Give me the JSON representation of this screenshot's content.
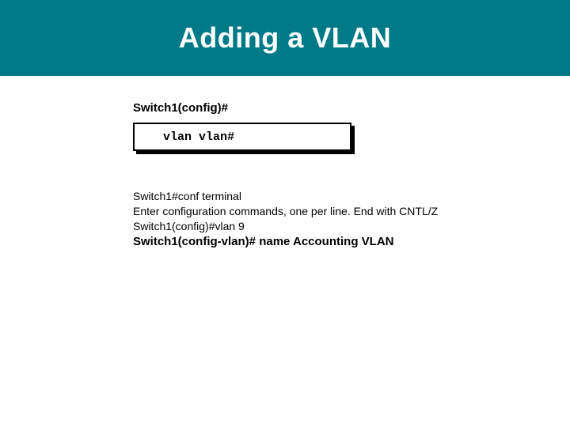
{
  "title": "Adding a  VLAN",
  "prompt": "Switch1(config)#",
  "codebox": "vlan vlan#",
  "transcript": {
    "line1": "Switch1#conf terminal",
    "line2": "Enter configuration commands, one per line.  End with CNTL/Z",
    "line3": "Switch1(config)#vlan 9",
    "line4_prefix": "Switch1(config-vlan)#",
    "line4_rest": " name Accounting VLAN"
  }
}
